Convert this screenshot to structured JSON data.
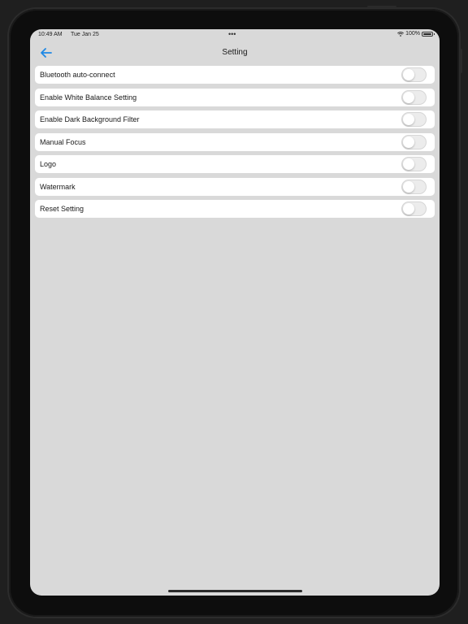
{
  "status_bar": {
    "time": "10:49 AM",
    "date": "Tue Jan 25",
    "dots": "•••",
    "battery": "100%"
  },
  "nav": {
    "title": "Setting"
  },
  "settings": [
    {
      "label": "Bluetooth auto-connect",
      "enabled": false
    },
    {
      "label": "Enable White Balance Setting",
      "enabled": false
    },
    {
      "label": "Enable Dark Background Filter",
      "enabled": false
    },
    {
      "label": "Manual Focus",
      "enabled": false
    },
    {
      "label": "Logo",
      "enabled": false
    },
    {
      "label": "Watermark",
      "enabled": false
    },
    {
      "label": "Reset Setting",
      "enabled": false
    }
  ],
  "colors": {
    "accent": "#1e88e5",
    "screen_bg": "#d9d9d9",
    "row_bg": "#ffffff",
    "toggle_off": "#ececec"
  },
  "icons": {
    "back": "arrow-left-icon",
    "wifi": "wifi-icon",
    "battery": "battery-icon"
  }
}
